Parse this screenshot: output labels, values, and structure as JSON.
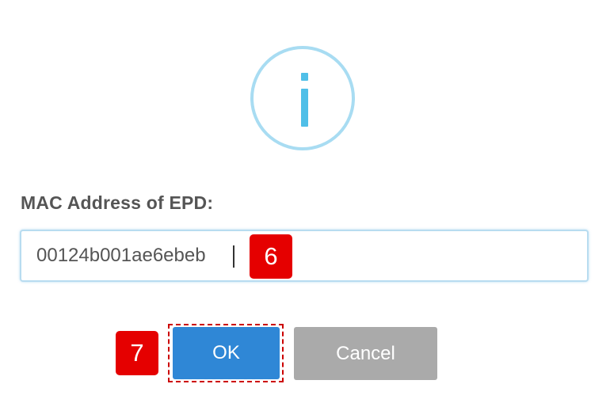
{
  "dialog": {
    "icon": "info-icon",
    "label": "MAC Address of EPD:",
    "mac_value": "00124b001ae6ebeb",
    "ok_label": "OK",
    "cancel_label": "Cancel"
  },
  "annotations": {
    "step_input": "6",
    "step_ok": "7",
    "badge_color": "#e50000"
  },
  "colors": {
    "ok_button": "#2f87d6",
    "cancel_button": "#aaaaaa",
    "icon": "#4fbfe8"
  }
}
